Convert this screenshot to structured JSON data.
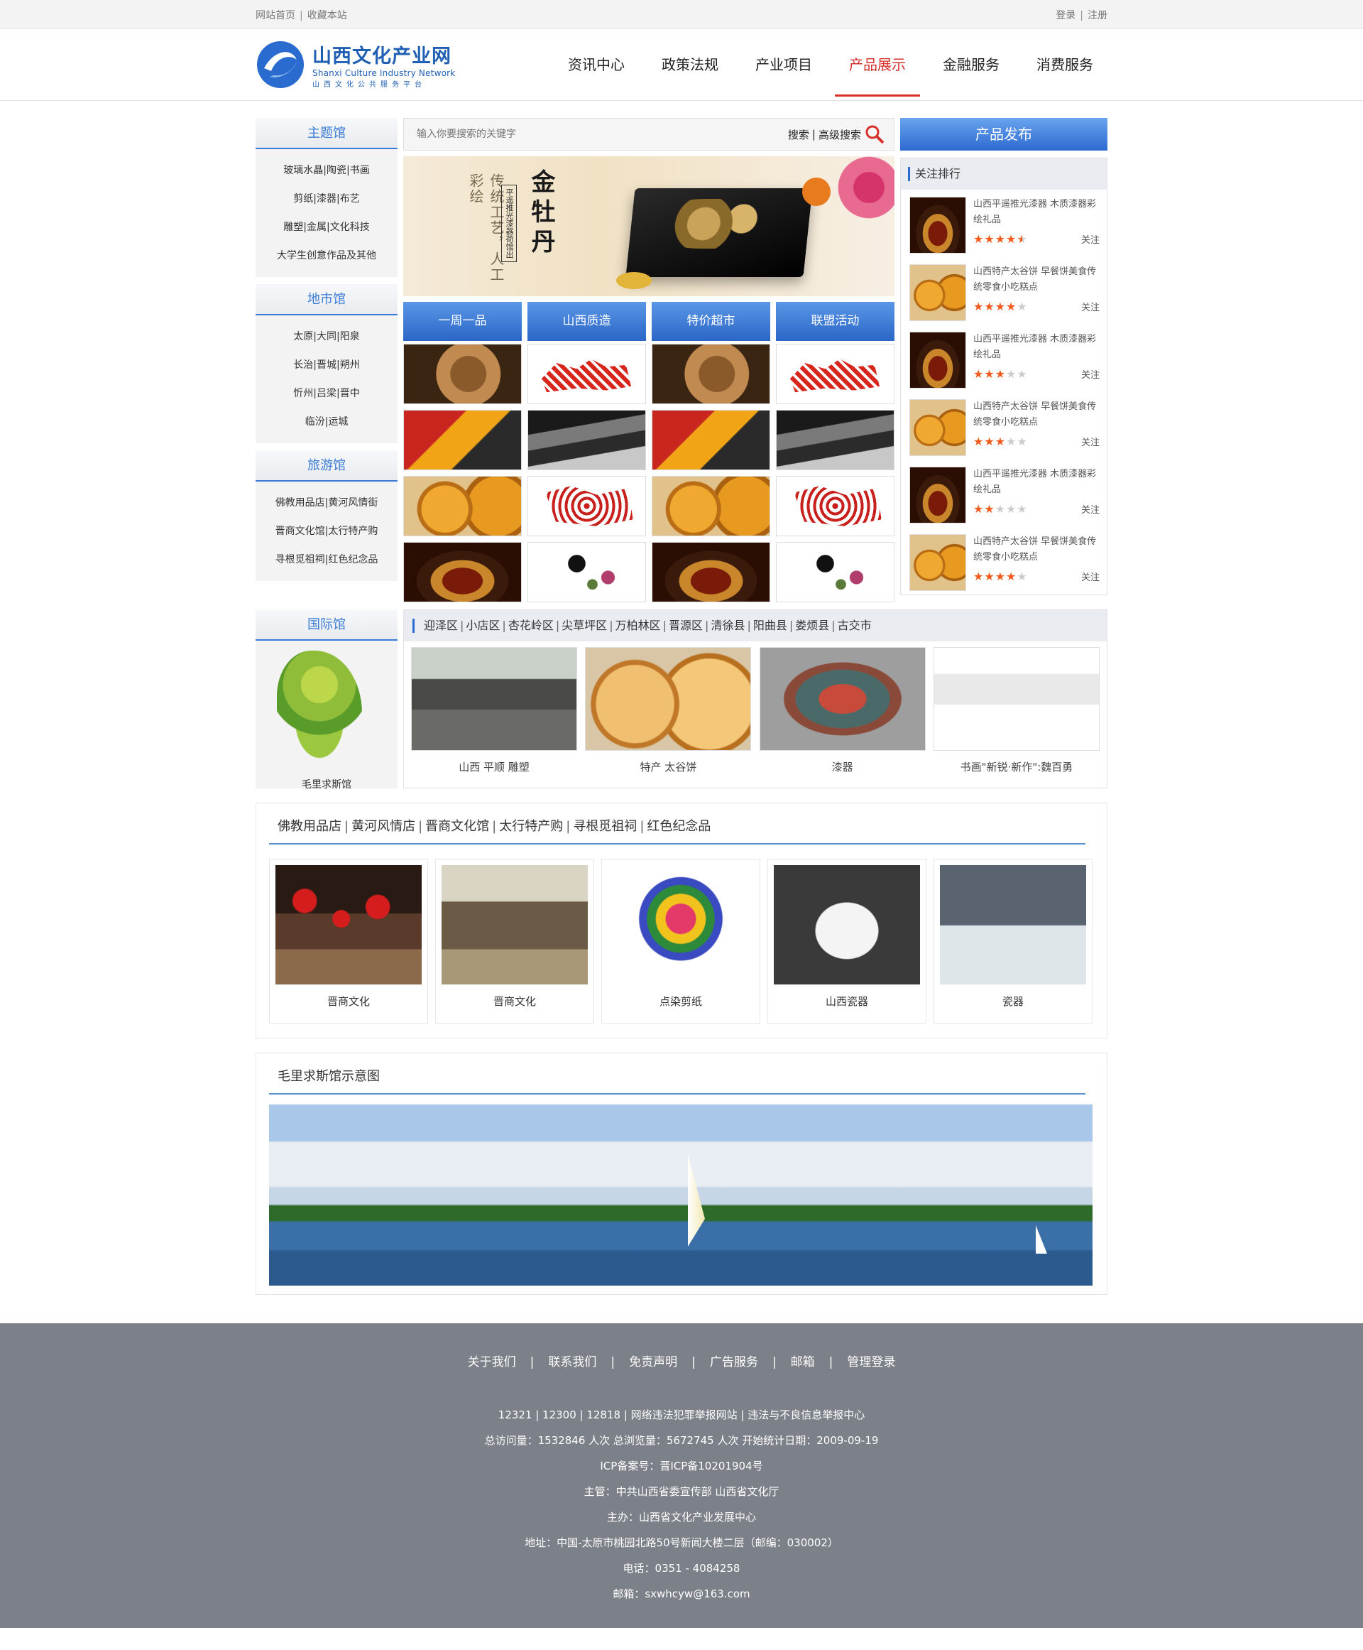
{
  "topbar": {
    "home": "网站首页",
    "bookmark": "收藏本站",
    "login": "登录",
    "register": "注册"
  },
  "logo": {
    "cn": "山西文化产业网",
    "en": "Shanxi Culture Industry Network",
    "sub": "山西文化公共服务平台"
  },
  "nav": [
    "资讯中心",
    "政策法规",
    "产业项目",
    "产品展示",
    "金融服务",
    "消费服务"
  ],
  "nav_active": "产品展示",
  "sidebar": {
    "theme": {
      "title": "主题馆",
      "items": [
        "玻璃水晶|陶瓷|书画",
        "剪纸|漆器|布艺",
        "雕塑|金属|文化科技",
        "大学生创意作品及其他"
      ]
    },
    "city": {
      "title": "地市馆",
      "items": [
        "太原|大同|阳泉",
        "长治|晋城|朔州",
        "忻州|吕梁|晋中",
        "临汾|运城"
      ]
    },
    "tour": {
      "title": "旅游馆",
      "items": [
        "佛教用品店|黄河风情街",
        "晋商文化馆|太行特产购",
        "寻根觅祖祠|红色纪念品"
      ]
    },
    "intl": {
      "title": "国际馆",
      "map_label": "毛里求斯馆"
    }
  },
  "search": {
    "placeholder": "输入你要搜索的关键字",
    "search_label": "搜索",
    "advanced_label": "高级搜索"
  },
  "banner": {
    "title": "金牡丹",
    "scroll_text": "传统工艺，人工彩绘",
    "scroll_sub": "平遥推光漆器荷馆出"
  },
  "tabs": [
    "一周一品",
    "山西质造",
    "特价超市",
    "联盟活动"
  ],
  "publish": "产品发布",
  "rank": {
    "title": "关注排行",
    "follow": "关注",
    "items": [
      {
        "name": "山西平遥推光漆器 木质漆器彩绘礼品",
        "stars": 4.5,
        "img": "bowl"
      },
      {
        "name": "山西特产太谷饼 早餐饼美食传统零食小吃糕点",
        "stars": 4,
        "img": "cake"
      },
      {
        "name": "山西平遥推光漆器 木质漆器彩绘礼品",
        "stars": 3,
        "img": "bowl"
      },
      {
        "name": "山西特产太谷饼 早餐饼美食传统零食小吃糕点",
        "stars": 3,
        "img": "cake"
      },
      {
        "name": "山西平遥推光漆器 木质漆器彩绘礼品",
        "stars": 2,
        "img": "bowl"
      },
      {
        "name": "山西特产太谷饼 早餐饼美食传统零食小吃糕点",
        "stars": 4,
        "img": "cake"
      }
    ]
  },
  "districts": [
    "迎泽区",
    "小店区",
    "杏花岭区",
    "尖草坪区",
    "万柏林区",
    "晋源区",
    "清徐县",
    "阳曲县",
    "娄烦县",
    "古交市"
  ],
  "district_products": [
    {
      "label": "山西 平顺 雕塑",
      "img": "statue"
    },
    {
      "label": "特产 太谷饼",
      "img": "cake"
    },
    {
      "label": "漆器",
      "img": "lacquer"
    },
    {
      "label": "书画\"新锐·新作\":魏百勇",
      "img": "paint"
    }
  ],
  "tour_panel": {
    "links": [
      "佛教用品店",
      "黄河风情店",
      "晋商文化馆",
      "太行特产购",
      "寻根觅祖祠",
      "红色纪念品"
    ],
    "items": [
      {
        "label": "晋商文化",
        "img": "lantern"
      },
      {
        "label": "晋商文化",
        "img": "street"
      },
      {
        "label": "点染剪纸",
        "img": "papercut"
      },
      {
        "label": "山西瓷器",
        "img": "white"
      },
      {
        "label": "瓷器",
        "img": "teaset"
      }
    ]
  },
  "mauritius": {
    "title": "毛里求斯馆示意图"
  },
  "footer": {
    "links": [
      "关于我们",
      "联系我们",
      "免责声明",
      "广告服务",
      "邮箱",
      "管理登录"
    ],
    "lines": [
      "12321 | 12300 | 12818 | 网络违法犯罪举报网站 | 违法与不良信息举报中心",
      "总访问量：1532846 人次  总浏览量：5672745 人次  开始统计日期：2009-09-19",
      "ICP备案号：晋ICP备10201904号",
      "主管：中共山西省委宣传部 山西省文化厅",
      "主办：山西省文化产业发展中心",
      "地址：中国-太原市桃园北路50号新闻大楼二层（邮编：030002）",
      "电话：0351 - 4084258",
      "邮箱：sxwhcyw@163.com"
    ]
  },
  "colors": {
    "accent_blue": "#2c6ad0",
    "nav_active_red": "#d8312c",
    "star": "#f25a1e",
    "footer_bg": "#7c8088"
  }
}
